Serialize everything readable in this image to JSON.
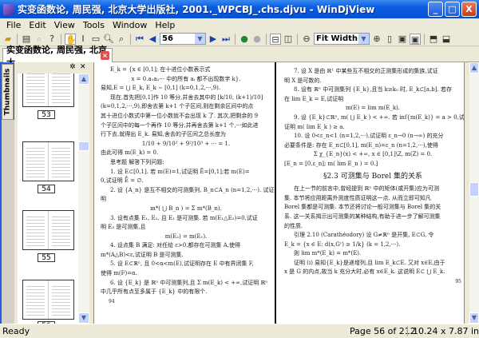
{
  "window": {
    "title": "实变函数论, 周民强, 北京大学出版社, 2001._WPCBJ_.chs.djvu - WinDjView",
    "minimize": "_",
    "maximize": "□",
    "close": "X"
  },
  "menu": [
    "File",
    "Edit",
    "View",
    "Tools",
    "Window",
    "Help"
  ],
  "toolbar": {
    "page_value": "56",
    "zoom_value": "Fit Width",
    "icons": [
      "open-icon",
      "print-icon",
      "find-icon",
      "help-icon",
      "hand-icon",
      "select-text-icon",
      "select-rect-icon",
      "zoom-icon",
      "zoom-rect-icon",
      "first-page-icon",
      "prev-page-icon",
      "next-page-icon",
      "last-page-icon",
      "back-icon",
      "forward-icon",
      "continuous-icon",
      "facing-icon",
      "zoom-out-icon",
      "zoom-in-icon",
      "actual-size-icon",
      "fit-page-icon",
      "fit-width-icon",
      "rotate-left-icon",
      "rotate-right-icon"
    ]
  },
  "tab": {
    "label": "实变函数论, 周民强, 北京大..."
  },
  "sidebar": {
    "tab_label": "Thumbnails",
    "thumbnails": [
      "53",
      "54",
      "55",
      "56"
    ]
  },
  "pages": {
    "left": {
      "lines": [
        "E_k = {x ∈ [0,1]; 在十进位小数表示式",
        "x = 0.a₁a₂··· 中的所有 aᵢ 都不出现数字 k}.",
        "易知,E = ⋃ E_k, E_k ∼ [0,1] (k=0,1,2,···,9).",
        "现在,首先把[0,1]作 10 等分,并舍去其中的 [k/10, (k+1)/10]",
        "(k=0,1,2,···,9),即舍去第 k+1 个子区间,则在剩余区间中的点",
        "其十进位小数式中第一位小数就不会出现 k 了. 其次,把剩余的 9",
        "个子区间中的每一个再作 10 等分,并再舍去第 k+1 个,···如此进",
        "行下去,就得出 E_k. 易知,舍去的子区间之总长度为",
        "1/10 + 9/10² + 9²/10³ + ··· = 1.",
        "由此可得  m(E_k) = 0.",
        "思考题  解答下列问题:",
        "1. 设 E⊂[0,1]. 若 m(E)=1,试证明 Ē=[0,1];若 m(E)=",
        "0,试证明 E̊ = ∅.",
        "2. 设 {A_n} 是互不相交的可测集列, B_n⊂A_n (n=1,2,···). 试证",
        "明",
        "m*( ⋃ B_n ) = Σ m*(B_n).",
        "3. 设有点集 E₁, E₂, 且 E₁ 是可测集. 若 m(E₁△E₂)=0,试证",
        "明 E₂ 是可测集,且",
        "m(E₂) = m(E₁).",
        "4. 设点集 B 满足: 对任给 ε>0,都存在可测集 A,使得",
        "m*(A△B)<ε,试证明 B 是可测集.",
        "5. 设 E⊂ℝⁿ, 且 0<α<m(E),试证明存在 E 中有界闭集 F,",
        "使得 m(F)=α.",
        "6. 设 {E_k} 是 ℝⁿ 中可测集列,且 Σ m(E_k) < +∞,试证明 ℝⁿ",
        "中几乎所有点至多属于 {E_k} 中的有限个."
      ],
      "page_number": "94"
    },
    "right": {
      "lines": [
        "7. 设 X 是由 ℝ¹ 中某些互不相交的正测集形成的集族,试证",
        "明 X 是可数的.",
        "8. 设有 ℝⁿ 中可测集列 {E_k},且当 k≥k₀ 时, E_k⊂[a,b]. 若存",
        "在 lim E_k = E,试证明",
        "m(E) = lim m(E_k).",
        "9. 设 {E_k}⊂ℝⁿ, m( ⋃ E_k ) < +∞. 若 inf{m(E_k)} = a > 0,试",
        "证明 m( lim E_k ) ≥ a.",
        "10. 设 0<ε_n<1 (n=1,2,···),试证明 ε_n→0 (n→∞) 的充分",
        "必要条件是: 存在 E_n⊂[0,1], m(E_n)=ε_n (n=1,2,···),使得",
        "Σ χ_{E_n}(x) < +∞,  x ∈ [0,1]\\Z,  m(Z) = 0.",
        "[E_n = [0,ε_n]; m( lim E_n ) = 0.]",
        "§2.3  可测集与 Borel 集的关系",
        "在上一节的前言中,曾经提到 ℝⁿ 中的矩体(或开集)应为可测",
        "集. 本节将应用距离外测度性质证明这一点. 从而立即可知凡",
        "Borel 集都是可测集. 本节还将讨论一般可测集与 Borel 集的关",
        "系. 这一关系揭示出可测集的某种结构,有助于进一步了解可测集",
        "的性质.",
        "引理 2.10 (Carathéodory)  设 G≠ℝⁿ 是开集, E⊂G, 令",
        "E_k = {x ∈ E: d(x,Gᶜ) ≥ 1/k}  (k = 1,2,···).",
        "则          lim m*(E_k) = m*(E).",
        "证明  (i) 易知{E_k}是递增列,且 lim E_k⊂E. 又对 x∈E,由于",
        "x 是 G 的内点,故当 k 充分大时,必有 x∈E_k. 这说明 E⊂ ⋃ E_k."
      ],
      "page_number": "95"
    }
  },
  "status": {
    "text": "Ready",
    "page": "Page 56 of 212",
    "size": "10.24 x 7.87 in"
  }
}
